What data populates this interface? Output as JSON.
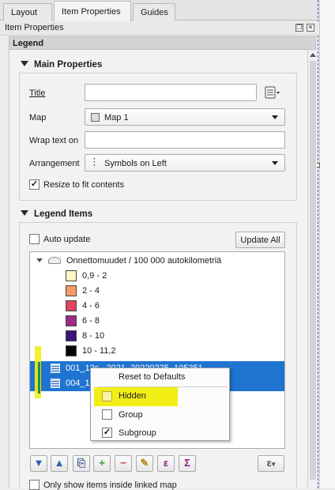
{
  "tabs": [
    "Layout",
    "Item Properties",
    "Guides"
  ],
  "panel_title": "Item Properties",
  "section_header": "Legend",
  "main_properties": {
    "heading": "Main Properties",
    "title_label": "Title",
    "title_value": "",
    "map_label": "Map",
    "map_value": "Map 1",
    "wrap_label": "Wrap text on",
    "wrap_value": "",
    "arrangement_label": "Arrangement",
    "arrangement_value": "Symbols on Left",
    "resize_label": "Resize to fit contents",
    "resize_checked": true
  },
  "legend_items": {
    "heading": "Legend Items",
    "auto_update_label": "Auto update",
    "update_all_label": "Update All",
    "layer_name": "Onnettomuudet / 100 000 autokilometriä",
    "classes": [
      {
        "label": "0,9 - 2",
        "color": "#fff7c0"
      },
      {
        "label": "2 - 4",
        "color": "#f79a6a"
      },
      {
        "label": "4 - 6",
        "color": "#e2455f"
      },
      {
        "label": "6 - 8",
        "color": "#9c2a86"
      },
      {
        "label": "8 - 10",
        "color": "#3a1478"
      },
      {
        "label": "10 - 11,2",
        "color": "#050505"
      }
    ],
    "selected_layers": [
      "001_12s...2021_20220225_105351",
      "004_12i"
    ]
  },
  "context_menu": {
    "reset_label": "Reset to Defaults",
    "items": [
      {
        "label": "Hidden",
        "checked": false
      },
      {
        "label": "Group",
        "checked": false
      },
      {
        "label": "Subgroup",
        "checked": true
      }
    ]
  },
  "bottom": {
    "only_show_label": "Only show items inside linked map"
  },
  "colors": {
    "selection": "#1f74d1",
    "highlight": "#f2ee15",
    "accent_marker": "#2f8f2f"
  }
}
